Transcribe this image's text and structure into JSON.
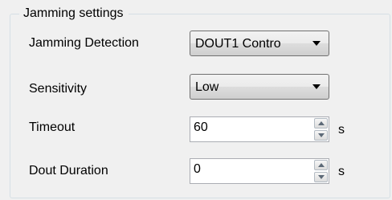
{
  "group": {
    "title": "Jamming settings"
  },
  "jamming_detection": {
    "label": "Jamming Detection",
    "value": "DOUT1 Contro"
  },
  "sensitivity": {
    "label": "Sensitivity",
    "value": "Low"
  },
  "timeout": {
    "label": "Timeout",
    "value": "60",
    "unit": "s"
  },
  "dout_duration": {
    "label": "Dout Duration",
    "value": "0",
    "unit": "s"
  },
  "icons": {
    "dropdown": "chevron-down-icon",
    "spin_up": "spin-up-icon",
    "spin_down": "spin-down-icon"
  }
}
